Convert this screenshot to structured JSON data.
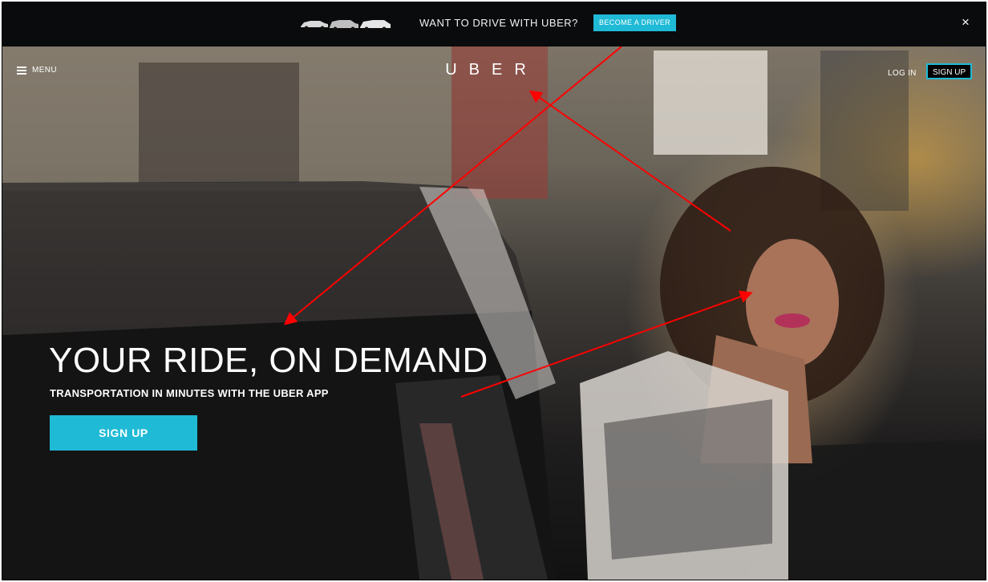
{
  "promo": {
    "text": "WANT TO DRIVE WITH UBER?",
    "button_label": "BECOME A DRIVER",
    "close_symbol": "×"
  },
  "nav": {
    "menu_label": "MENU",
    "logo_text": "UBER",
    "login_label": "LOG IN",
    "signup_label": "SIGN UP"
  },
  "hero": {
    "headline": "YOUR RIDE, ON DEMAND",
    "subline": "TRANSPORTATION IN MINUTES WITH THE UBER APP",
    "signup_label": "SIGN UP"
  },
  "icons": {
    "menu": "hamburger-icon",
    "close": "close-icon",
    "promo_cars": "car-lineup-icon"
  },
  "colors": {
    "accent": "#1fbad6",
    "promo_bg": "#0a0b0c",
    "annotation_arrow": "#ff0000"
  }
}
